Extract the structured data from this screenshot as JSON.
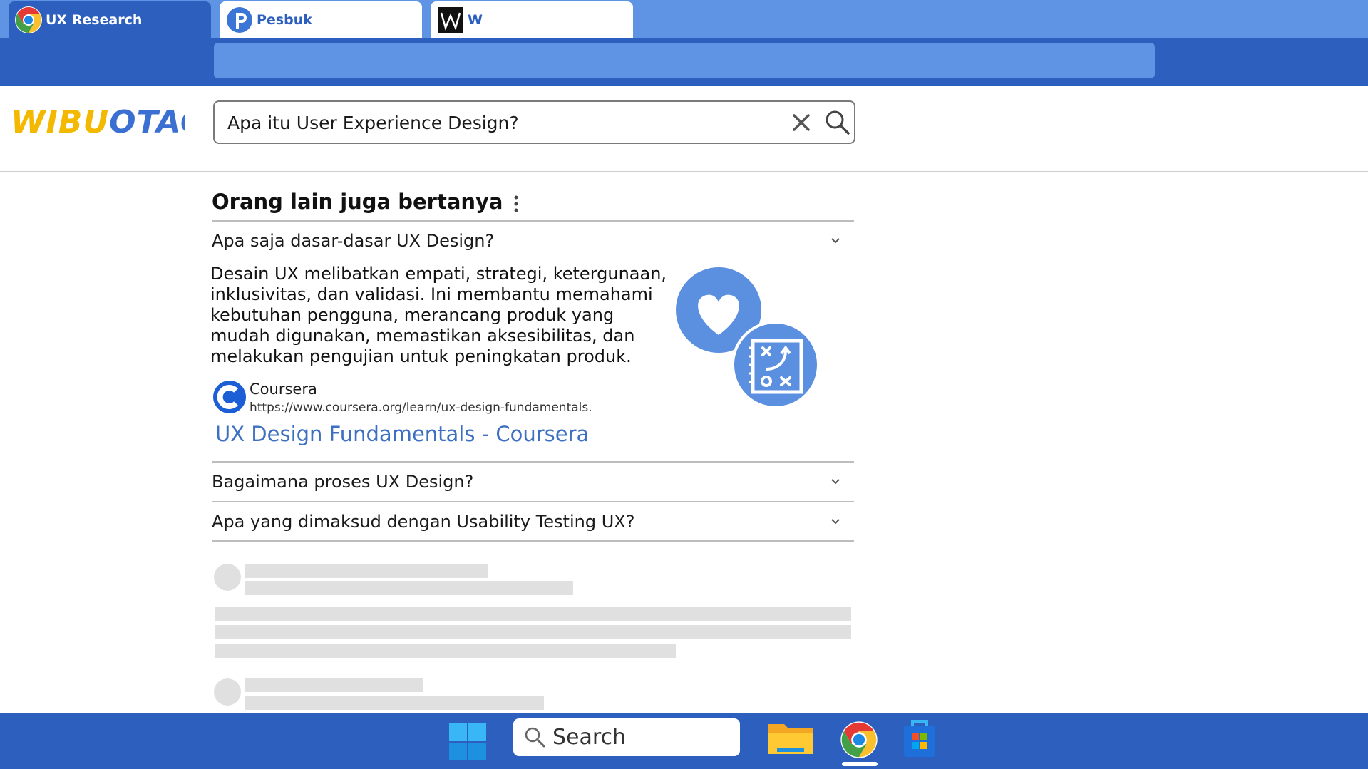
{
  "browser": {
    "tabs": [
      {
        "label": "UX Research",
        "icon": "chrome-icon",
        "active": true
      },
      {
        "label": "Pesbuk",
        "icon": "pesbuk-p-icon",
        "active": false
      },
      {
        "label": "W",
        "icon": "w-logo-icon",
        "active": false
      }
    ],
    "address": ""
  },
  "colors": {
    "chrome_dark": "#2c5fbe",
    "chrome_light": "#5e94e3",
    "link": "#3d6fc2",
    "logo_yellow": "#f3b800",
    "logo_blue": "#3b6fd1"
  },
  "search": {
    "logo": "WIBUOTACK!",
    "query": "Apa itu User Experience Design?",
    "clear_icon": "close-icon",
    "submit_icon": "search-icon"
  },
  "paa": {
    "title": "Orang lain juga bertanya",
    "questions": [
      {
        "text": "Apa saja dasar-dasar UX Design?",
        "expanded": true
      },
      {
        "text": "Bagaimana proses UX Design?",
        "expanded": false
      },
      {
        "text": "Apa yang dimaksud dengan Usability Testing UX?",
        "expanded": false
      }
    ],
    "answer": {
      "text": "Desain UX melibatkan empati, strategi, ketergunaan, inklusivitas, dan validasi. Ini membantu memahami kebutuhan pengguna, merancang produk yang mudah digunakan, memastikan aksesibilitas, dan melakukan pengujian untuk peningkatan produk.",
      "source_name": "Coursera",
      "source_url": "https://www.coursera.org/learn/ux-design-fundamentals.",
      "link_title": "UX Design Fundamentals - Coursera",
      "illustration": "heart-and-strategy-icon"
    }
  },
  "taskbar": {
    "search_label": "Search",
    "items": [
      "windows-start-icon",
      "file-explorer-icon",
      "chrome-icon",
      "store-icon"
    ]
  }
}
